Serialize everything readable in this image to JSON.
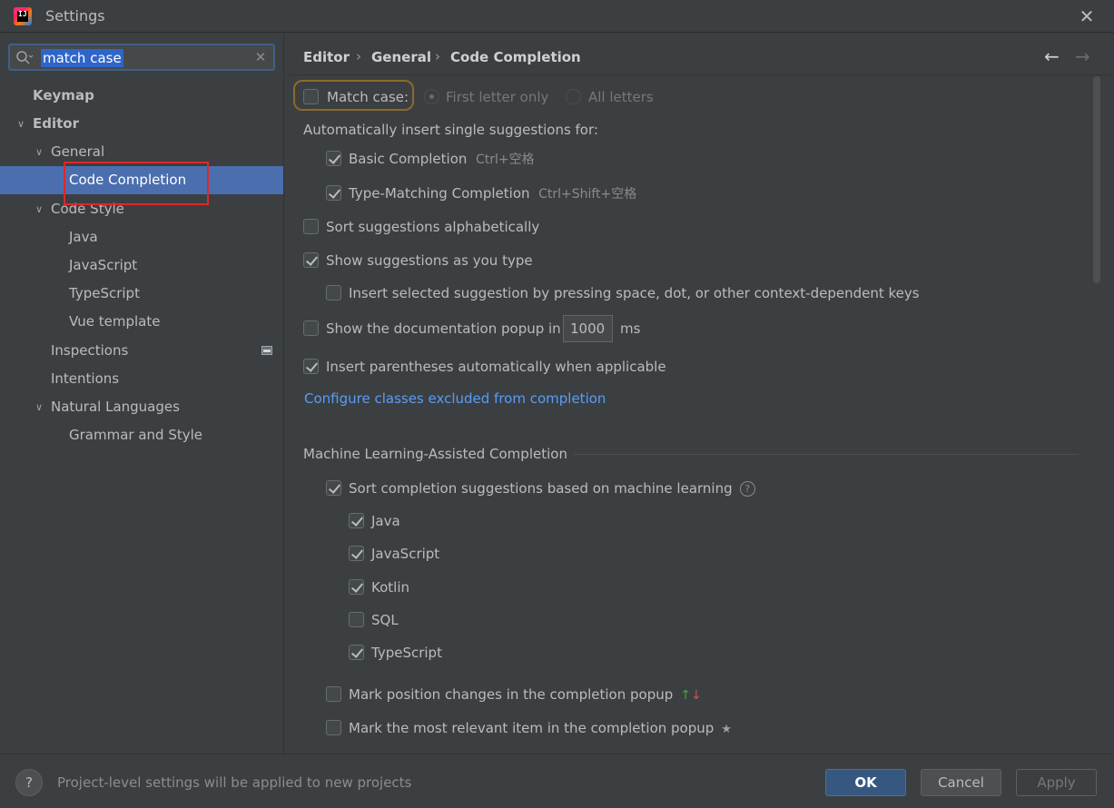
{
  "window": {
    "title": "Settings",
    "logo_text": "IJ"
  },
  "search": {
    "value": "match case",
    "placeholder": ""
  },
  "sidebar": {
    "items": [
      {
        "label": "Keymap"
      },
      {
        "label": "Editor"
      },
      {
        "label": "General"
      },
      {
        "label": "Code Completion"
      },
      {
        "label": "Code Style"
      },
      {
        "label": "Java"
      },
      {
        "label": "JavaScript"
      },
      {
        "label": "TypeScript"
      },
      {
        "label": "Vue template"
      },
      {
        "label": "Inspections"
      },
      {
        "label": "Intentions"
      },
      {
        "label": "Natural Languages"
      },
      {
        "label": "Grammar and Style"
      }
    ]
  },
  "breadcrumb": {
    "parts": [
      "Editor",
      "General",
      "Code Completion"
    ],
    "separator": "›"
  },
  "content": {
    "match_case": "Match case:",
    "first_letter": "First letter only",
    "all_letters": "All letters",
    "auto_insert_heading": "Automatically insert single suggestions for:",
    "basic_completion": "Basic Completion",
    "basic_shortcut": "Ctrl+空格",
    "type_matching": "Type-Matching Completion",
    "type_matching_shortcut": "Ctrl+Shift+空格",
    "sort_alpha": "Sort suggestions alphabetically",
    "show_as_type": "Show suggestions as you type",
    "insert_selected": "Insert selected suggestion by pressing space, dot, or other context-dependent keys",
    "show_doc_popup": "Show the documentation popup in",
    "doc_ms_value": "1000",
    "ms_label": "ms",
    "insert_parens": "Insert parentheses automatically when applicable",
    "configure_link": "Configure classes excluded from completion",
    "ml_heading": "Machine Learning-Assisted Completion",
    "ml_sort": "Sort completion suggestions based on machine learning",
    "ml_languages": [
      "Java",
      "JavaScript",
      "Kotlin",
      "SQL",
      "TypeScript"
    ],
    "mark_position": "Mark position changes in the completion popup",
    "mark_relevant": "Mark the most relevant item in the completion popup"
  },
  "footer": {
    "help": "?",
    "message": "Project-level settings will be applied to new projects",
    "ok": "OK",
    "cancel": "Cancel",
    "apply": "Apply"
  }
}
